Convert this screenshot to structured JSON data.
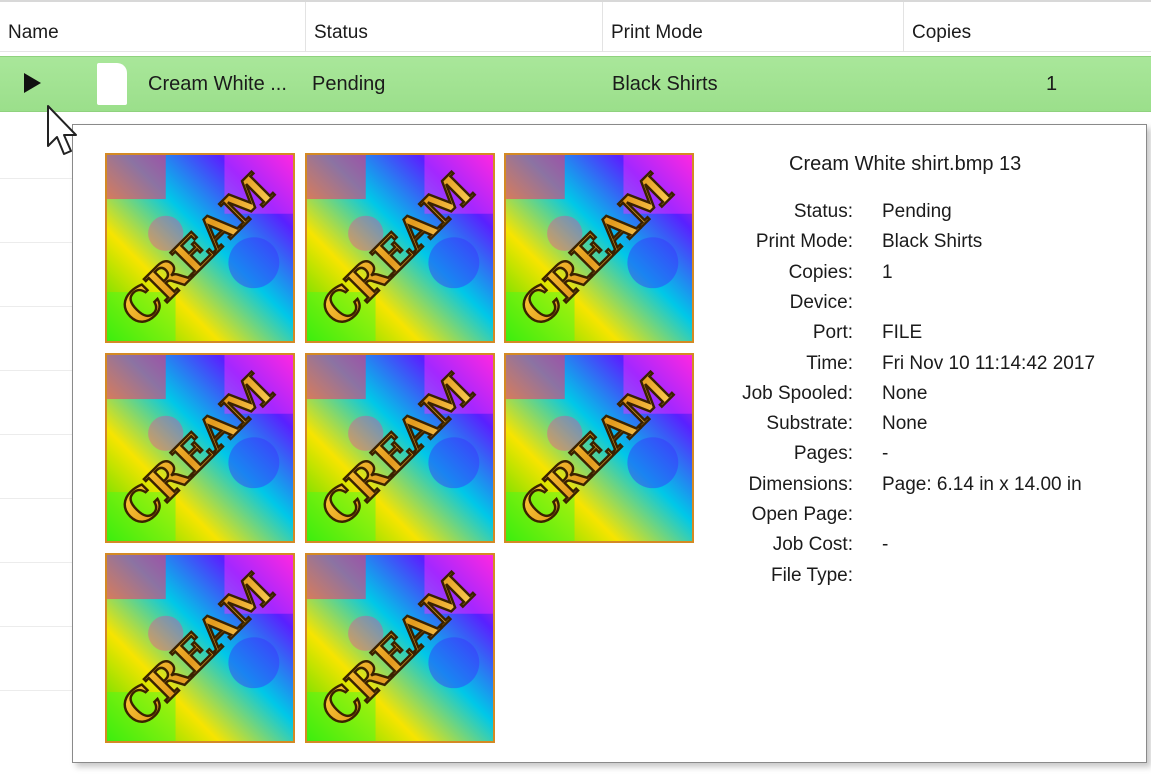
{
  "columns": {
    "name": "Name",
    "status": "Status",
    "print_mode": "Print Mode",
    "copies": "Copies"
  },
  "selected_row": {
    "name": "Cream White ...",
    "status": "Pending",
    "print_mode": "Black Shirts",
    "copies": "1"
  },
  "popup": {
    "title": "Cream White shirt.bmp 13",
    "thumbnail_count": 8,
    "thumbnail_icon": "cream-shirt-design-image",
    "thumbnail_text": "CREAM",
    "details": [
      {
        "label": "Status:",
        "value": "Pending"
      },
      {
        "label": "Print Mode:",
        "value": "Black Shirts"
      },
      {
        "label": "Copies:",
        "value": "1"
      },
      {
        "label": "Device:",
        "value": ""
      },
      {
        "label": "Port:",
        "value": "FILE"
      },
      {
        "label": "Time:",
        "value": "Fri Nov 10 11:14:42 2017"
      },
      {
        "label": "Job Spooled:",
        "value": "None"
      },
      {
        "label": "Substrate:",
        "value": "None"
      },
      {
        "label": "Pages:",
        "value": "-"
      },
      {
        "label": "Dimensions:",
        "value": "Page: 6.14 in x 14.00 in"
      },
      {
        "label": "Open Page:",
        "value": ""
      },
      {
        "label": "Job Cost:",
        "value": "-"
      },
      {
        "label": "File Type:",
        "value": ""
      }
    ]
  },
  "colors": {
    "selection": "#a4e494",
    "thumbnail_border": "#d48a24"
  }
}
